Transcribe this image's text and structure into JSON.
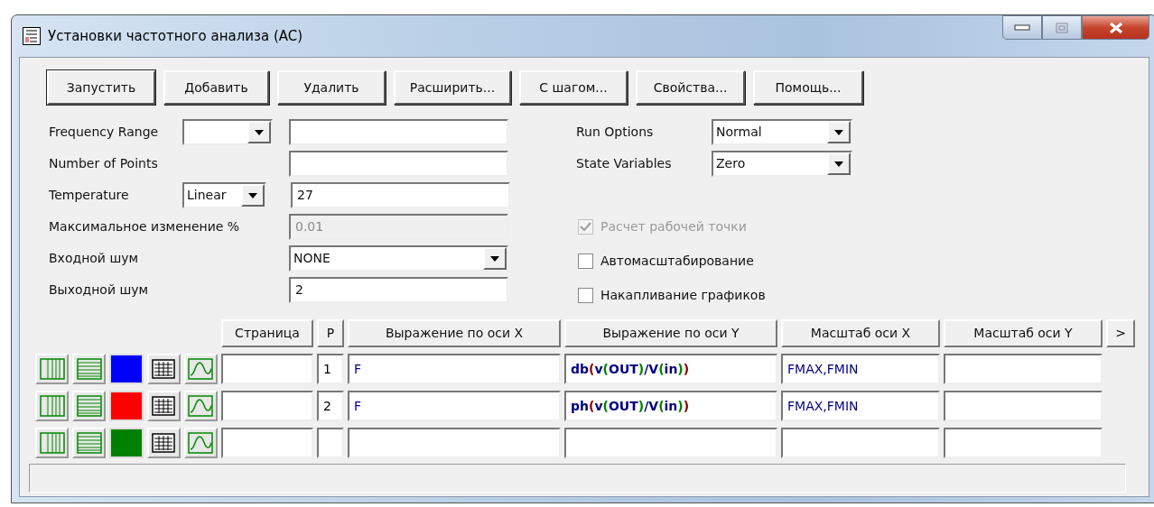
{
  "window": {
    "title": "Установки частотного анализа (AC)"
  },
  "buttons": [
    {
      "label": "Запустить",
      "default": true
    },
    {
      "label": "Добавить",
      "default": false
    },
    {
      "label": "Удалить",
      "default": false
    },
    {
      "label": "Расширить...",
      "default": false
    },
    {
      "label": "С шагом...",
      "default": false
    },
    {
      "label": "Свойства...",
      "default": false
    },
    {
      "label": "Помощь...",
      "default": false
    }
  ],
  "left_fields": [
    {
      "label": "Frequency Range",
      "kind": "combo-text"
    },
    {
      "label": "Number of Points",
      "kind": "text"
    },
    {
      "label": "Temperature",
      "kind": "combo-text",
      "combo": "Linear",
      "value": "27"
    },
    {
      "label": "Максимальное изменение %",
      "kind": "text",
      "value": "0.01",
      "disabled": true
    },
    {
      "label": "Входной шум",
      "kind": "dropdown",
      "value": "NONE"
    },
    {
      "label": "Выходной шум",
      "kind": "text",
      "value": "2"
    }
  ],
  "right_fields": [
    {
      "label": "Run Options",
      "value": "Normal"
    },
    {
      "label": "State Variables",
      "value": "Zero"
    }
  ],
  "checkboxes": [
    {
      "label": "Расчет рабочей точки",
      "checked": true,
      "disabled": true
    },
    {
      "label": "Автомасштабирование",
      "checked": false,
      "disabled": false
    },
    {
      "label": "Накапливание графиков",
      "checked": false,
      "disabled": false
    }
  ],
  "table": {
    "columns": [
      "Страница",
      "P",
      "Выражение по оси X",
      "Выражение по оси Y",
      "Масштаб оси X",
      "Масштаб оси Y"
    ],
    "more_button": ">",
    "rows": [
      {
        "color": "#0000ff",
        "p": "1",
        "x_expr": "F",
        "y_expr": [
          {
            "text": "db",
            "color": "#000080"
          },
          {
            "text": "(",
            "color": "#8b0000"
          },
          {
            "text": "v",
            "color": "#000080"
          },
          {
            "text": "(",
            "color": "#008000"
          },
          {
            "text": "OUT",
            "color": "#000080"
          },
          {
            "text": ")",
            "color": "#008000"
          },
          {
            "text": "/V",
            "color": "#000080"
          },
          {
            "text": "(",
            "color": "#008000"
          },
          {
            "text": "in",
            "color": "#000080"
          },
          {
            "text": ")",
            "color": "#008000"
          },
          {
            "text": ")",
            "color": "#8b0000"
          }
        ],
        "x_scale": "FMAX,FMIN"
      },
      {
        "color": "#ff0000",
        "p": "2",
        "x_expr": "F",
        "y_expr": [
          {
            "text": "ph",
            "color": "#000080"
          },
          {
            "text": "(",
            "color": "#8b0000"
          },
          {
            "text": "v",
            "color": "#000080"
          },
          {
            "text": "(",
            "color": "#008000"
          },
          {
            "text": "OUT",
            "color": "#000080"
          },
          {
            "text": ")",
            "color": "#008000"
          },
          {
            "text": "/V",
            "color": "#000080"
          },
          {
            "text": "(",
            "color": "#008000"
          },
          {
            "text": "in",
            "color": "#000080"
          },
          {
            "text": ")",
            "color": "#008000"
          },
          {
            "text": ")",
            "color": "#8b0000"
          }
        ],
        "x_scale": "FMAX,FMIN"
      },
      {
        "color": "#008000"
      }
    ]
  }
}
